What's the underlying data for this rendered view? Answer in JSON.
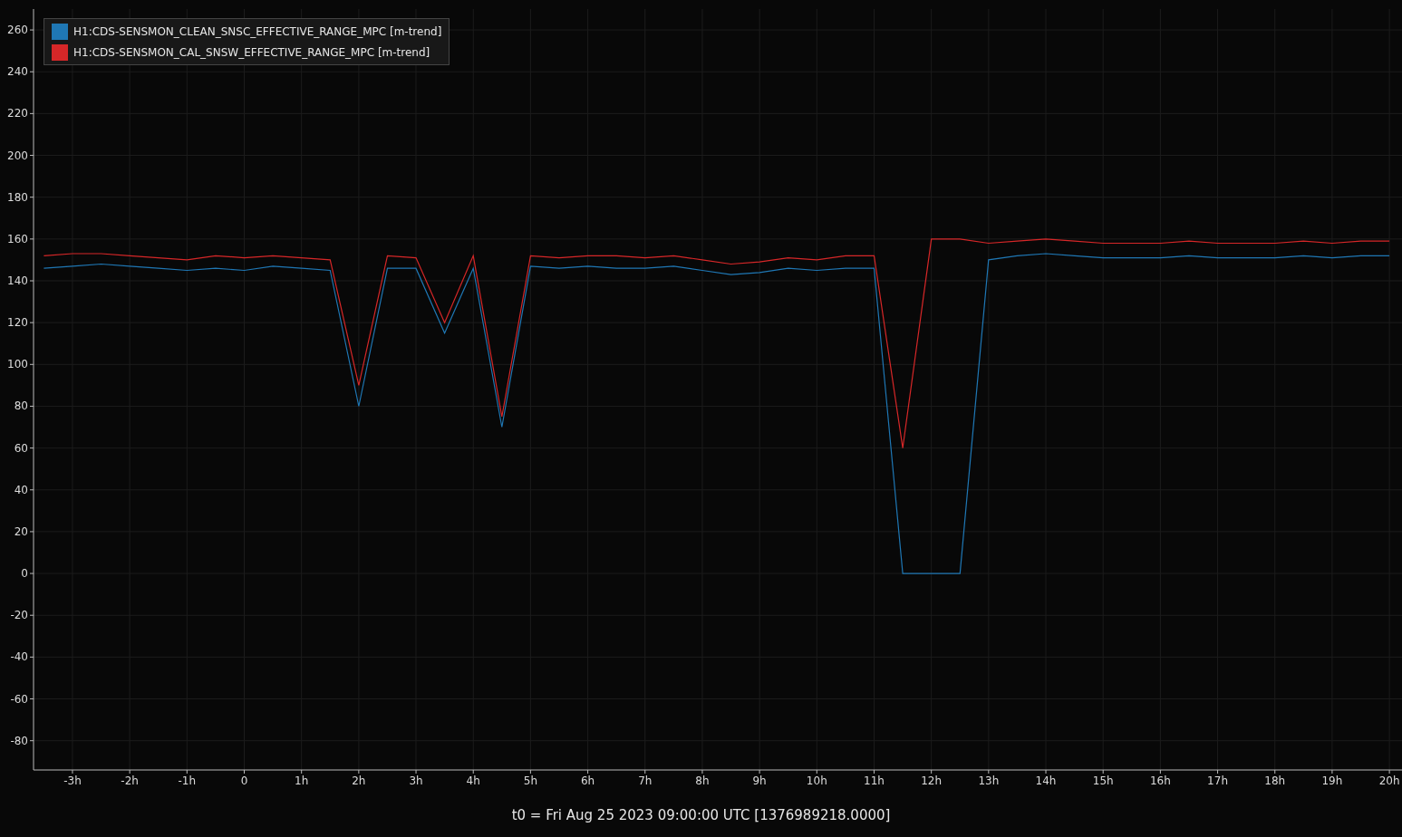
{
  "chart_data": {
    "type": "line",
    "grid": true,
    "legend": "top-left",
    "xlabel": "t0 = Fri Aug 25 2023 09:00:00 UTC [1376989218.0000]",
    "x": [
      -3.5,
      -3,
      -2.5,
      -2,
      -1.5,
      -1,
      -0.5,
      0,
      0.5,
      1,
      1.5,
      2,
      2.5,
      3,
      3.5,
      4,
      4.5,
      5,
      5.5,
      6,
      6.5,
      7,
      7.5,
      8,
      8.5,
      9,
      9.5,
      10,
      10.5,
      11,
      11.5,
      12,
      12.5,
      13,
      13.5,
      14,
      14.5,
      15,
      15.5,
      16,
      16.5,
      17,
      17.5,
      18,
      18.5,
      19,
      19.5,
      20
    ],
    "series": [
      {
        "name": "H1:CDS-SENSMON_CLEAN_SNSC_EFFECTIVE_RANGE_MPC [m-trend]",
        "color": "#1f77b4",
        "values": [
          146,
          147,
          148,
          147,
          146,
          145,
          146,
          145,
          147,
          146,
          145,
          80,
          146,
          146,
          115,
          146,
          70,
          147,
          146,
          147,
          146,
          146,
          147,
          145,
          143,
          144,
          146,
          145,
          146,
          146,
          0,
          0,
          0,
          150,
          152,
          153,
          152,
          151,
          151,
          151,
          152,
          151,
          151,
          151,
          152,
          151,
          152,
          152
        ]
      },
      {
        "name": "H1:CDS-SENSMON_CAL_SNSW_EFFECTIVE_RANGE_MPC [m-trend]",
        "color": "#d62728",
        "values": [
          152,
          153,
          153,
          152,
          151,
          150,
          152,
          151,
          152,
          151,
          150,
          90,
          152,
          151,
          120,
          152,
          75,
          152,
          151,
          152,
          152,
          151,
          152,
          150,
          148,
          149,
          151,
          150,
          152,
          152,
          60,
          160,
          160,
          158,
          159,
          160,
          159,
          158,
          158,
          158,
          159,
          158,
          158,
          158,
          159,
          158,
          159,
          159
        ]
      }
    ],
    "xlim": [
      -3.68,
      20.22
    ],
    "ylim": [
      -94,
      270
    ],
    "xticks": [
      {
        "value": -3,
        "label": "-3h"
      },
      {
        "value": -2,
        "label": "-2h"
      },
      {
        "value": -1,
        "label": "-1h"
      },
      {
        "value": 0,
        "label": "0"
      },
      {
        "value": 1,
        "label": "1h"
      },
      {
        "value": 2,
        "label": "2h"
      },
      {
        "value": 3,
        "label": "3h"
      },
      {
        "value": 4,
        "label": "4h"
      },
      {
        "value": 5,
        "label": "5h"
      },
      {
        "value": 6,
        "label": "6h"
      },
      {
        "value": 7,
        "label": "7h"
      },
      {
        "value": 8,
        "label": "8h"
      },
      {
        "value": 9,
        "label": "9h"
      },
      {
        "value": 10,
        "label": "10h"
      },
      {
        "value": 11,
        "label": "11h"
      },
      {
        "value": 12,
        "label": "12h"
      },
      {
        "value": 13,
        "label": "13h"
      },
      {
        "value": 14,
        "label": "14h"
      },
      {
        "value": 15,
        "label": "15h"
      },
      {
        "value": 16,
        "label": "16h"
      },
      {
        "value": 17,
        "label": "17h"
      },
      {
        "value": 18,
        "label": "18h"
      },
      {
        "value": 19,
        "label": "19h"
      },
      {
        "value": 20,
        "label": "20h"
      }
    ],
    "yticks": [
      -80,
      -60,
      -40,
      -20,
      0,
      20,
      40,
      60,
      80,
      100,
      120,
      140,
      160,
      180,
      200,
      220,
      240,
      260
    ]
  }
}
